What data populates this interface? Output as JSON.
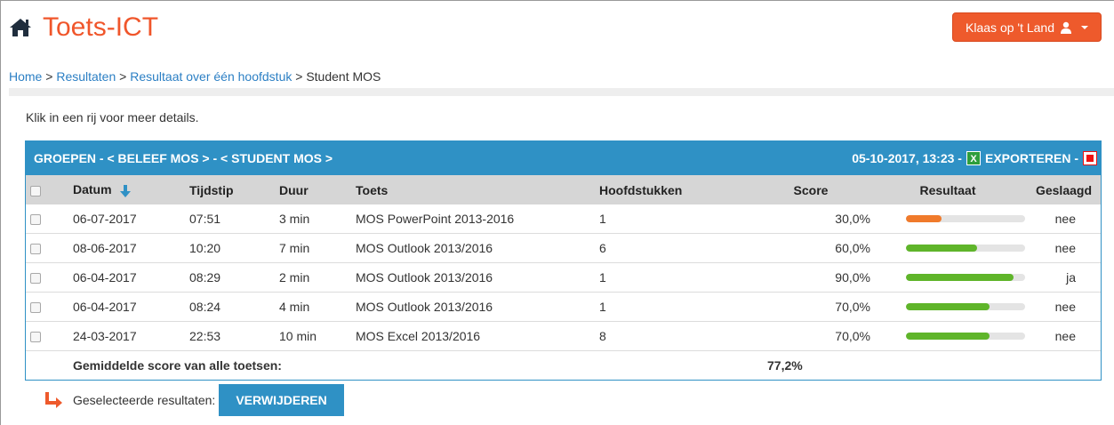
{
  "app": {
    "title": "Toets-ICT"
  },
  "user_menu": {
    "label": "Klaas op 't Land"
  },
  "breadcrumb": {
    "items": [
      "Home",
      "Resultaten",
      "Resultaat over één hoofdstuk"
    ],
    "separator": ">",
    "current": "Student MOS"
  },
  "hint": "Klik in een rij voor meer details.",
  "panel": {
    "title": "GROEPEN - < BELEEF MOS > - < STUDENT MOS >",
    "timestamp": "05-10-2017, 13:23 -",
    "export_label": "EXPORTEREN -"
  },
  "table": {
    "columns": [
      "Datum",
      "Tijdstip",
      "Duur",
      "Toets",
      "Hoofdstukken",
      "Score",
      "Resultaat",
      "Geslaagd"
    ],
    "rows": [
      {
        "date": "06-07-2017",
        "time": "07:51",
        "duration": "3 min",
        "test": "MOS PowerPoint 2013-2016",
        "chapters": "1",
        "score": "30,0%",
        "result": 0.3,
        "passed": "nee"
      },
      {
        "date": "08-06-2017",
        "time": "10:20",
        "duration": "7 min",
        "test": "MOS Outlook 2013/2016",
        "chapters": "6",
        "score": "60,0%",
        "result": 0.6,
        "passed": "nee"
      },
      {
        "date": "06-04-2017",
        "time": "08:29",
        "duration": "2 min",
        "test": "MOS Outlook 2013/2016",
        "chapters": "1",
        "score": "90,0%",
        "result": 0.9,
        "passed": "ja"
      },
      {
        "date": "06-04-2017",
        "time": "08:24",
        "duration": "4 min",
        "test": "MOS Outlook 2013/2016",
        "chapters": "1",
        "score": "70,0%",
        "result": 0.7,
        "passed": "nee"
      },
      {
        "date": "24-03-2017",
        "time": "22:53",
        "duration": "10 min",
        "test": "MOS Excel 2013/2016",
        "chapters": "8",
        "score": "70,0%",
        "result": 0.7,
        "passed": "nee"
      }
    ],
    "average_label": "Gemiddelde score van alle toetsen:",
    "average_value": "77,2%"
  },
  "actions": {
    "selected_label": "Geselecteerde resultaten:",
    "delete_label": "VERWIJDEREN"
  },
  "colors": {
    "accent": "#f0562b",
    "primary": "#2f91c5",
    "bar_fail_low": "#f07a2b",
    "bar_ok": "#5fb52a"
  },
  "icons": {
    "home": "home-icon",
    "user": "user-icon",
    "sort": "sort-down-arrow-icon",
    "excel": "excel-icon",
    "pdf": "pdf-icon",
    "arrow": "corner-down-right-arrow-icon"
  }
}
